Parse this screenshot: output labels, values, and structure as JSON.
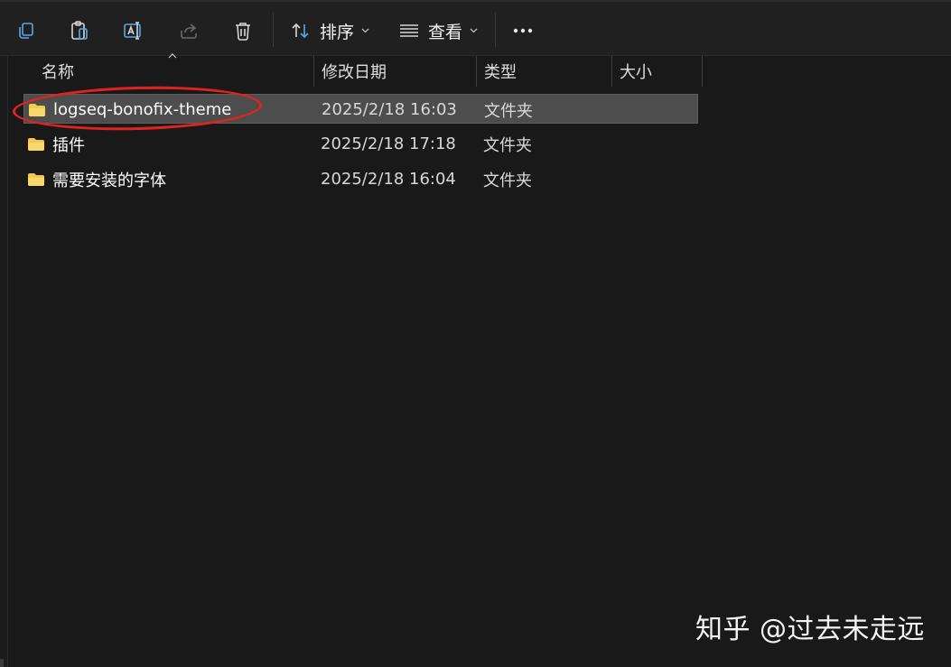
{
  "toolbar": {
    "sort_label": "排序",
    "view_label": "查看"
  },
  "columns": {
    "name": "名称",
    "modified": "修改日期",
    "type": "类型",
    "size": "大小"
  },
  "files": [
    {
      "name": "logseq-bonofix-theme",
      "modified": "2025/2/18 16:03",
      "type": "文件夹",
      "size": ""
    },
    {
      "name": "插件",
      "modified": "2025/2/18 17:18",
      "type": "文件夹",
      "size": ""
    },
    {
      "name": "需要安装的字体",
      "modified": "2025/2/18 16:04",
      "type": "文件夹",
      "size": ""
    }
  ],
  "watermark": "知乎 @过去未走远",
  "colors": {
    "background": "#191919",
    "toolbar": "#202020",
    "selected_row": "#4d4d4d",
    "folder": "#f2c94c",
    "annotation": "#e0231f"
  },
  "icons": [
    "copy-icon",
    "paste-icon",
    "rename-icon",
    "share-icon",
    "delete-icon",
    "sort-icon",
    "view-icon",
    "more-icon",
    "folder-icon"
  ]
}
